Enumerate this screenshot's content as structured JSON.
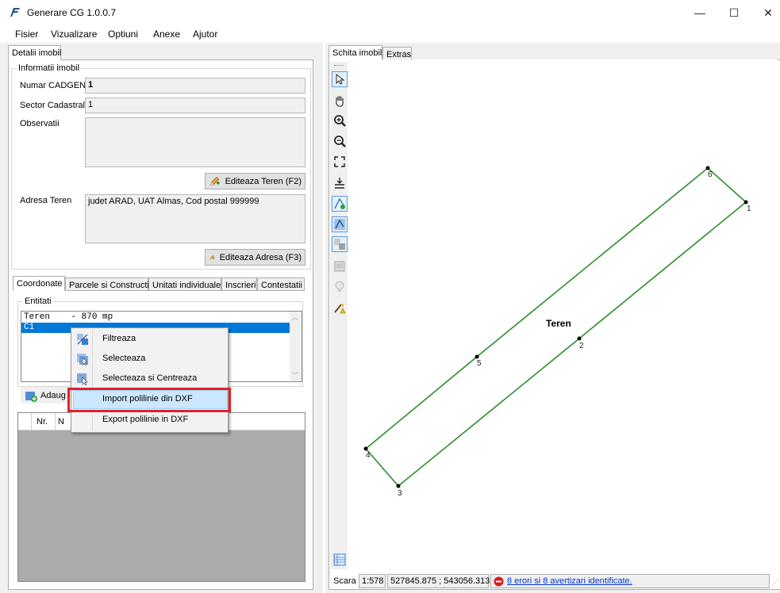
{
  "window": {
    "title": "Generare CG 1.0.0.7",
    "minimize": "—",
    "maximize": "☐",
    "close": "✕"
  },
  "menu": [
    "Fisier",
    "Vizualizare",
    "Optiuni",
    "Anexe",
    "Ajutor"
  ],
  "left_tabs": {
    "detalii": "Detalii imobil"
  },
  "informatii": {
    "group_title": "Informatii imobil",
    "numar_cadgen_label": "Numar CADGEN",
    "numar_cadgen_value": "1",
    "sector_label": "Sector Cadastral",
    "sector_value": "1",
    "observatii_label": "Observatii",
    "observatii_value": "",
    "edit_teren_button": "Editeaza Teren (F2)",
    "adresa_label": "Adresa Teren",
    "adresa_value": "judet ARAD, UAT Almas, Cod postal 999999",
    "edit_adresa_button": "Editeaza Adresa (F3)"
  },
  "lower_tabs": [
    "Coordonate",
    "Parcele si Constructii",
    "Unitati individuale",
    "Inscrieri",
    "Contestatii"
  ],
  "entitati": {
    "group_title": "Entitati",
    "items": [
      "Teren    - 870 mp",
      "C1"
    ],
    "add_button": "Adaug"
  },
  "grid": {
    "col_nr": "Nr.",
    "col_n": "N"
  },
  "context_menu": {
    "items": [
      "Filtreaza",
      "Selecteaza",
      "Selecteaza si Centreaza",
      "Import polilinie din DXF",
      "Export polilinie in DXF"
    ]
  },
  "right_tabs": [
    "Schita imobil",
    "Extras"
  ],
  "sketch": {
    "parcel_label": "Teren",
    "vertices": [
      {
        "label": "1"
      },
      {
        "label": "2"
      },
      {
        "label": "3"
      },
      {
        "label": "4"
      },
      {
        "label": "5"
      },
      {
        "label": "6"
      }
    ],
    "line_color": "#2e8b2e"
  },
  "status": {
    "scale_label": "Scara",
    "scale_value": "1:578",
    "coords": "527845.875 ; 543056.313",
    "errors_link": "8 erori si 8 avertizari identificate."
  }
}
